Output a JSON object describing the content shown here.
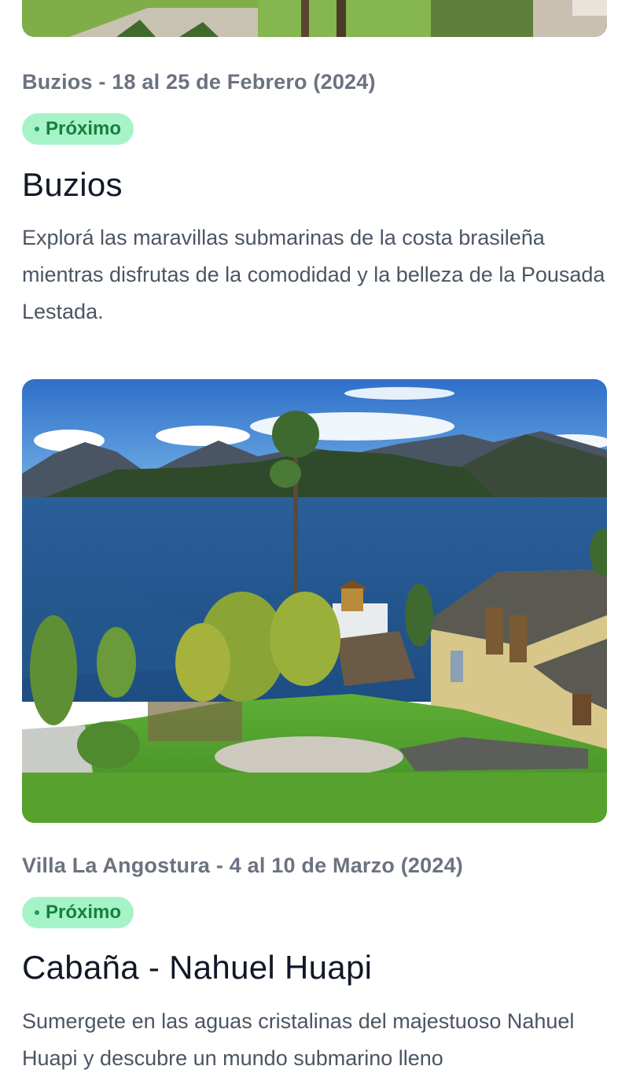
{
  "cards": [
    {
      "meta": "Buzios - 18 al 25 de Febrero (2024)",
      "badge": "Próximo",
      "title": "Buzios",
      "description": "Explorá las maravillas submarinas de la costa brasileña mientras disfrutas de la comodidad y la belleza de la Pousada Lestada."
    },
    {
      "meta": "Villa La Angostura - 4 al 10 de Marzo (2024)",
      "badge": "Próximo",
      "title": "Cabaña - Nahuel Huapi",
      "description": "Sumergete en las aguas cristalinas del majestuoso Nahuel Huapi y descubre un mundo submarino lleno"
    }
  ],
  "colors": {
    "badge_bg": "#a7f3c8",
    "badge_text": "#15803d",
    "meta_text": "#6b7280",
    "title_text": "#111827"
  }
}
